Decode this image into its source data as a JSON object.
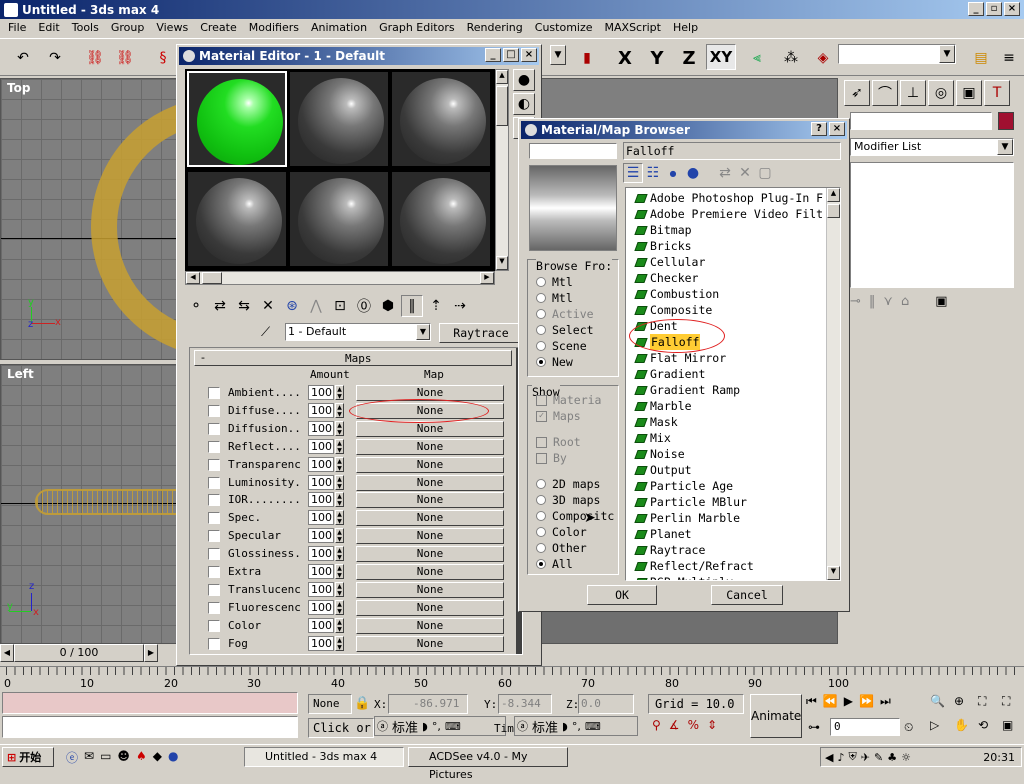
{
  "app": {
    "title": "Untitled - 3ds max 4"
  },
  "menu": [
    "File",
    "Edit",
    "Tools",
    "Group",
    "Views",
    "Create",
    "Modifiers",
    "Animation",
    "Graph Editors",
    "Rendering",
    "Customize",
    "MAXScript",
    "Help"
  ],
  "axes": [
    "X",
    "Y",
    "Z",
    "XY"
  ],
  "viewports": {
    "top": "Top",
    "left": "Left"
  },
  "material_editor": {
    "title": "Material Editor - 1 - Default",
    "material_name": "1 - Default",
    "type_button": "Raytrace",
    "rollout_title": "Maps",
    "col_amount": "Amount",
    "col_map": "Map",
    "rows": [
      {
        "label": "Ambient....",
        "amount": "100",
        "map": "None"
      },
      {
        "label": "Diffuse....",
        "amount": "100",
        "map": "None"
      },
      {
        "label": "Diffusion..",
        "amount": "100",
        "map": "None"
      },
      {
        "label": "Reflect....",
        "amount": "100",
        "map": "None"
      },
      {
        "label": "Transparenc",
        "amount": "100",
        "map": "None"
      },
      {
        "label": "Luminosity.",
        "amount": "100",
        "map": "None"
      },
      {
        "label": "IOR........",
        "amount": "100",
        "map": "None"
      },
      {
        "label": "Spec.",
        "amount": "100",
        "map": "None"
      },
      {
        "label": "Specular",
        "amount": "100",
        "map": "None"
      },
      {
        "label": "Glossiness.",
        "amount": "100",
        "map": "None"
      },
      {
        "label": "Extra",
        "amount": "100",
        "map": "None"
      },
      {
        "label": "Translucenc",
        "amount": "100",
        "map": "None"
      },
      {
        "label": "Fluorescenc",
        "amount": "100",
        "map": "None"
      },
      {
        "label": "Color",
        "amount": "100",
        "map": "None"
      },
      {
        "label": "Fog",
        "amount": "100",
        "map": "None"
      }
    ]
  },
  "browser": {
    "title": "Material/Map Browser",
    "search_value": "Falloff",
    "browse_from_label": "Browse Fro:",
    "browse_from": [
      "Mtl",
      "Mtl",
      "Active",
      "Select",
      "Scene",
      "New"
    ],
    "show_label": "Show",
    "show_options": [
      "Materia",
      "Maps",
      "Root",
      "By"
    ],
    "map_types": [
      "2D maps",
      "3D maps",
      "Compositc",
      "Color",
      "Other",
      "All"
    ],
    "items": [
      "Adobe Photoshop Plug-In F",
      "Adobe Premiere Video Filt",
      "Bitmap",
      "Bricks",
      "Cellular",
      "Checker",
      "Combustion",
      "Composite",
      "Dent",
      "Falloff",
      "Flat Mirror",
      "Gradient",
      "Gradient Ramp",
      "Marble",
      "Mask",
      "Mix",
      "Noise",
      "Output",
      "Particle Age",
      "Particle MBlur",
      "Perlin Marble",
      "Planet",
      "Raytrace",
      "Reflect/Refract",
      "RGB Multiply"
    ],
    "selected": "Falloff",
    "ok": "OK",
    "cancel": "Cancel"
  },
  "command_panel": {
    "modifier_list": "Modifier List"
  },
  "status": {
    "frame": "0 / 100",
    "ticks": [
      "0",
      "10",
      "20",
      "30",
      "40",
      "50",
      "60",
      "70",
      "80",
      "90",
      "100"
    ],
    "none": "None",
    "x_label": "X:",
    "x": "-86.971",
    "y_label": "Y:",
    "y": "-8.344",
    "z_label": "Z:",
    "z": "0.0",
    "grid": "Grid = 10.0",
    "animate": "Animate",
    "frame_field": "0",
    "click_or": "Click or",
    "tim": "Tim",
    "ime": "标准"
  },
  "taskbar": {
    "start": "开始",
    "tasks": [
      "Untitled - 3ds max 4",
      "ACDSee v4.0 - My Pictures"
    ],
    "time": "20:31"
  },
  "colors": {
    "titlebar": "#0a246a",
    "selection": "#0a246a",
    "highlight_falloff": "#ffcc33",
    "annotation_red": "#e02020",
    "green_sphere": "#22dd22"
  }
}
